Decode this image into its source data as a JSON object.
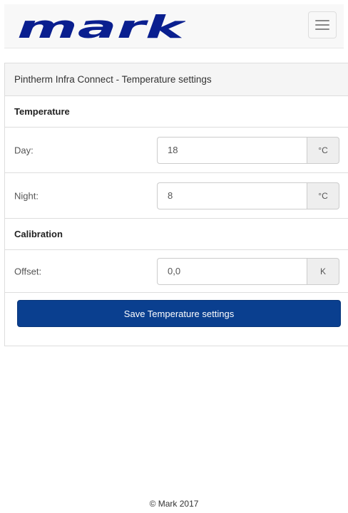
{
  "header": {
    "logo_text": "mark",
    "brand_color": "#0a1f8f",
    "menu_icon": "hamburger-icon"
  },
  "panel": {
    "title": "Pintherm Infra Connect - Temperature settings"
  },
  "temperature": {
    "section_title": "Temperature",
    "day": {
      "label": "Day:",
      "value": "18",
      "unit": "°C"
    },
    "night": {
      "label": "Night:",
      "value": "8",
      "unit": "°C"
    }
  },
  "calibration": {
    "section_title": "Calibration",
    "offset": {
      "label": "Offset:",
      "value": "0,0",
      "unit": "K"
    }
  },
  "actions": {
    "save_label": "Save Temperature settings",
    "save_color": "#0a3f8f"
  },
  "footer": {
    "copyright": "© Mark 2017"
  }
}
